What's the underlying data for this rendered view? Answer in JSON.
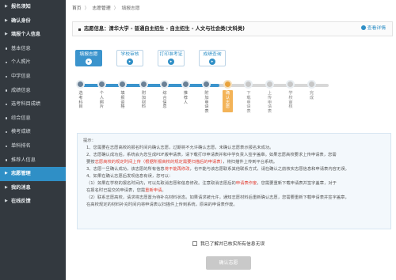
{
  "sidebar": {
    "items": [
      {
        "label": "报名须知",
        "type": "group"
      },
      {
        "label": "确认身份",
        "type": "group"
      },
      {
        "label": "填报个人信息",
        "type": "group"
      },
      {
        "label": "基本信息",
        "type": "sub"
      },
      {
        "label": "个人照片",
        "type": "sub"
      },
      {
        "label": "中学信息",
        "type": "sub"
      },
      {
        "label": "成绩信息",
        "type": "sub"
      },
      {
        "label": "选考科目成绩",
        "type": "sub"
      },
      {
        "label": "综合信息",
        "type": "sub"
      },
      {
        "label": "模考成绩",
        "type": "sub"
      },
      {
        "label": "单科排名",
        "type": "sub"
      },
      {
        "label": "推荐人信息",
        "type": "sub"
      },
      {
        "label": "志愿管理",
        "type": "group",
        "active": true
      },
      {
        "label": "我的消息",
        "type": "group"
      },
      {
        "label": "在线反馈",
        "type": "group"
      }
    ]
  },
  "breadcrumb": {
    "home": "首页",
    "sep": "〉",
    "section": "志愿管理",
    "current": "填报志愿"
  },
  "info_bar": {
    "text": "志愿信息：清华大学 - 普通自主招生 - 自主招生 - 人文与社会类(文科类)",
    "detail": "查看详情"
  },
  "tabs": [
    {
      "label": "填报志愿",
      "active": true
    },
    {
      "label": "学校审核",
      "active": false
    },
    {
      "label": "打印准考证",
      "active": false
    },
    {
      "label": "成绩查询",
      "active": false
    }
  ],
  "steps": [
    {
      "label": "选考科目",
      "state": "done"
    },
    {
      "label": "个人照片",
      "state": "done"
    },
    {
      "label": "填报资格",
      "state": "done"
    },
    {
      "label": "附加材料",
      "state": "done"
    },
    {
      "label": "综合信息",
      "state": "done"
    },
    {
      "label": "推荐人",
      "state": "done"
    },
    {
      "label": "附加申请表",
      "state": "done"
    },
    {
      "label": "确认志愿",
      "state": "current"
    },
    {
      "label": "下载申请表",
      "state": "todo"
    },
    {
      "label": "上传申请表",
      "state": "todo"
    },
    {
      "label": "学校审核",
      "state": "todo"
    },
    {
      "label": "完成",
      "state": "todo"
    }
  ],
  "notice": {
    "title": "提示：",
    "l1": "1、您需要在志愿高校的报名时间内确认志愿，过期将不允许确认志愿，未确认志愿表示报名未成功。",
    "l2": "2、志愿确认成功后，系统会为您生成PDF版申请表，请下载打印申请表并和中学负责人签字盖章。如果志愿高校要求上传申请表，您需",
    "l3a": "要按",
    "l3red": "志愿高校的规定时间上传（根据所报高校的规定需要扫描后的申请表）",
    "l3b": "，将扫描件上传到平台系统。",
    "l4a": "3、志愿一旦确认成功，该志愿的所有信息",
    "l4red": "将不能再修改",
    "l4b": "，也不能与该志愿联系其他联系方式，请在确认之前核实志愿信息和申请表内容无误。",
    "l5": "4、如果在确认志愿后发现信息有误，您可以：",
    "l6a": "（1）如果在学校的报名时间内，可以先取消志愿和信息修改。注意取消志愿后的",
    "l6red": "申请表作废",
    "l6b": "，您需要重新下载申请表并签字盖章，对于",
    "l7a": "在报名时已提交的申请表，您需",
    "l7red": "重新申请",
    "l7b": "。",
    "l8": "（2）联系志愿高校，请求将志愿置为待补充材料状态。如果请求被允许，通知志愿材料后重新确认志愿，您需要重新下载申请表并签字盖章，",
    "l9": "在高校规定的材料补充时间内将申请表以扫描件上传到系统，原来的申请表作废。"
  },
  "agree": {
    "label": "我已了解并已核实所有信息无误"
  },
  "confirm": {
    "label": "确认志愿"
  },
  "colors": {
    "accent": "#2f8fc6",
    "sidebar": "#33393f",
    "current_step": "#f3b358",
    "notice_red": "#e23b2e"
  }
}
